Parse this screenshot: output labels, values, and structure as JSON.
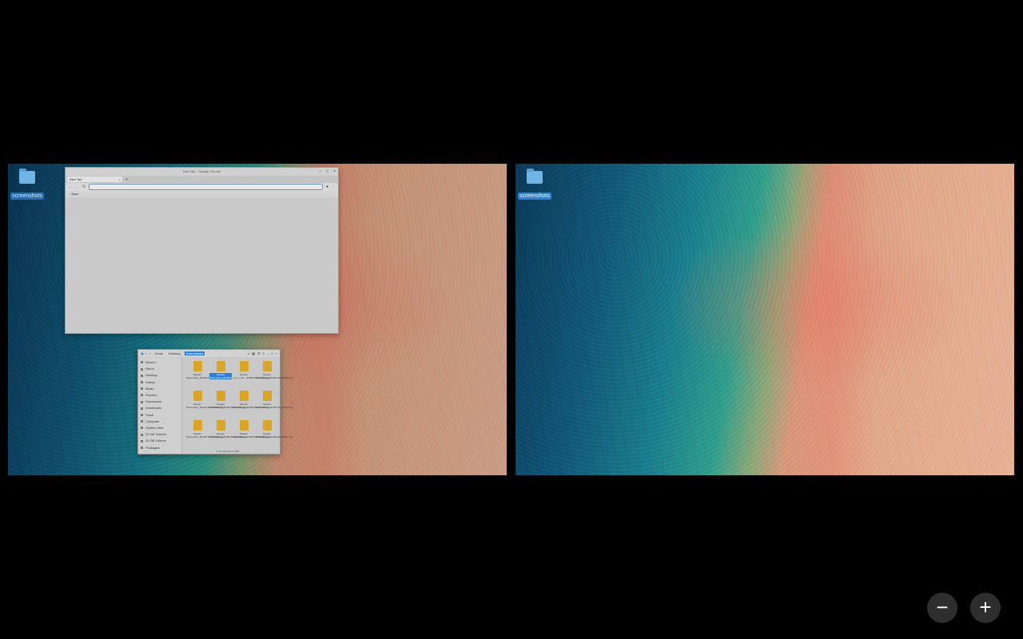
{
  "workspaces": [
    {
      "desktop_icon": {
        "label": "screenshots",
        "icon": "folder-icon"
      },
      "browser": {
        "title": "New Tab - Google Chrome",
        "tab_label": "New Tab",
        "new_tab_symbol": "+",
        "url_value": "",
        "bookmarks_label": "Apps"
      },
      "files": {
        "crumbs": [
          "Home",
          "Desktop",
          "screenshots"
        ],
        "sidebar": [
          "Recent",
          "Home",
          "Desktop",
          "Videos",
          "Music",
          "Pictures",
          "Documents",
          "Downloads",
          "Trash",
          "Computer",
          "System Disk",
          "20 GB Volume",
          "20 GB Volume",
          "Packages"
        ],
        "items": [
          "Deepin Screenshot_20190723171114.png",
          "Deepin Screenshot_20190723171342.png",
          "Deepin Screenshot_20190723171456.png",
          "Deepin Screenshot_20190723171618.png",
          "Deepin Screenshot_20190723171913.png",
          "Deepin Screenshot_20190723172101.png",
          "Deepin Screenshot_20190723172243.png",
          "Deepin Screenshot_20190723172410.png",
          "Deepin Screenshot_20190723172652.png",
          "Deepin Screenshot_20190723172758.png",
          "Deepin Screenshot_20190723172938.png",
          "Deepin Screenshot_20190723173047.png"
        ],
        "selected_index": 1,
        "status": "1 file selected (1 MB)"
      }
    },
    {
      "desktop_icon": {
        "label": "screenshots",
        "icon": "folder-icon"
      }
    }
  ],
  "zoom": {
    "out_symbol": "−",
    "in_symbol": "+"
  }
}
